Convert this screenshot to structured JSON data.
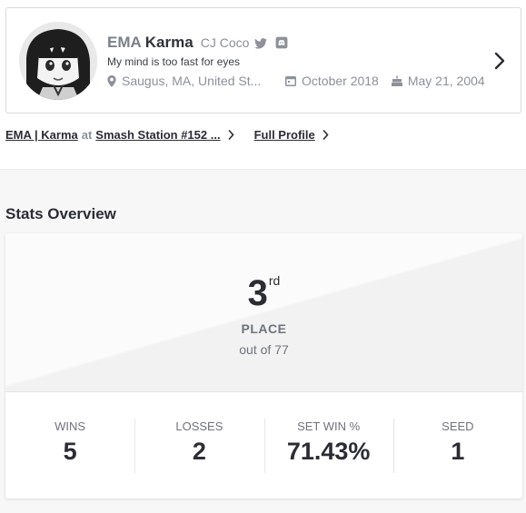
{
  "profile": {
    "prefix": "EMA",
    "gamertag": "Karma",
    "real_name": "CJ Coco",
    "bio": "My mind is too fast for eyes",
    "location": "Saugus, MA, United St...",
    "joined": "October 2018",
    "birthday": "May 21, 2004",
    "icons": {
      "social_1": "twitter-icon",
      "social_2": "discord-icon",
      "location": "map-pin-icon",
      "joined": "calendar-icon",
      "birthday": "birthday-cake-icon",
      "navigate": "chevron-right-icon"
    }
  },
  "links": {
    "entrant": "EMA | Karma",
    "at": "at",
    "event": "Smash Station #152 ...",
    "full_profile": "Full Profile"
  },
  "stats_overview": {
    "title": "Stats Overview",
    "placement": {
      "number": "3",
      "suffix": "rd",
      "label": "PLACE",
      "out_of": "out of 77"
    },
    "items": [
      {
        "label": "WINS",
        "value": "5"
      },
      {
        "label": "LOSSES",
        "value": "2"
      },
      {
        "label": "SET WIN %",
        "value": "71.43%"
      },
      {
        "label": "SEED",
        "value": "1"
      }
    ]
  },
  "colors": {
    "text_primary": "#2b2d33",
    "text_muted": "#8d9199",
    "border": "#d9dadd",
    "band": "#f7f7f8"
  }
}
